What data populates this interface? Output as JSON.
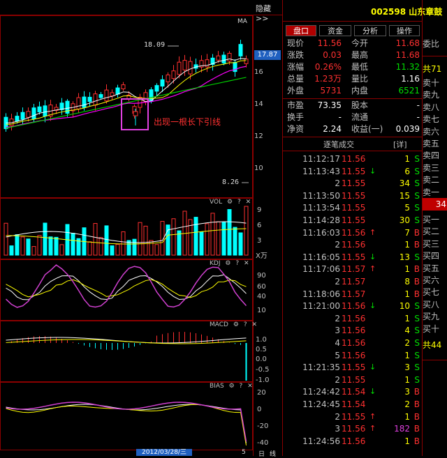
{
  "header": {
    "hide_label": "隐藏>>",
    "code_name": "002598  山东章鼓"
  },
  "tabs": [
    {
      "label": "盘口",
      "active": true
    },
    {
      "label": "资金",
      "active": false
    },
    {
      "label": "分析",
      "active": false
    },
    {
      "label": "操作",
      "active": false
    }
  ],
  "quote": [
    {
      "l1": "现价",
      "v1": "11.56",
      "l2": "今开",
      "v2": "11.68",
      "c2": "#ff3030"
    },
    {
      "l1": "涨跌",
      "v1": "0.03",
      "l2": "最高",
      "v2": "11.68",
      "c2": "#ff3030"
    },
    {
      "l1": "涨幅",
      "v1": "0.26%",
      "l2": "最低",
      "v2": "11.32",
      "c2": "#00e000"
    },
    {
      "l1": "总量",
      "v1": "1.23万",
      "l2": "量比",
      "v2": "1.16",
      "c2": "#ffffff"
    },
    {
      "l1": "外盘",
      "v1": "5731",
      "l2": "内盘",
      "v2": "6521",
      "c2": "#00e000"
    }
  ],
  "info": [
    {
      "l1": "市盈",
      "v1": "73.35",
      "l2": "股本",
      "v2": "-"
    },
    {
      "l1": "换手",
      "v1": "-",
      "l2": "流通",
      "v2": "-"
    },
    {
      "l1": "净资",
      "v1": "2.24",
      "l2": "收益(一)",
      "v2": "0.039"
    }
  ],
  "trades_header": {
    "title": "逐笔成交",
    "detail": "[详]"
  },
  "trades": [
    {
      "t": "11:12:17",
      "p": "11.56",
      "a": "",
      "ac": "",
      "v": "1",
      "d": "S",
      "dc": "#00e000"
    },
    {
      "t": "11:13:43",
      "p": "11.55",
      "a": "↓",
      "ac": "#00e000",
      "v": "6",
      "d": "S",
      "dc": "#00e000"
    },
    {
      "t": "2",
      "p": "11.55",
      "a": "",
      "ac": "",
      "v": "34",
      "d": "S",
      "dc": "#00e000"
    },
    {
      "t": "11:13:50",
      "p": "11.55",
      "a": "",
      "ac": "",
      "v": "15",
      "d": "S",
      "dc": "#00e000"
    },
    {
      "t": "11:13:54",
      "p": "11.55",
      "a": "",
      "ac": "",
      "v": "5",
      "d": "S",
      "dc": "#00e000"
    },
    {
      "t": "11:14:28",
      "p": "11.55",
      "a": "",
      "ac": "",
      "v": "30",
      "d": "S",
      "dc": "#00e000"
    },
    {
      "t": "11:16:03",
      "p": "11.56",
      "a": "↑",
      "ac": "#ff3030",
      "v": "7",
      "d": "B",
      "dc": "#ff3030"
    },
    {
      "t": "2",
      "p": "11.56",
      "a": "",
      "ac": "",
      "v": "1",
      "d": "B",
      "dc": "#ff3030"
    },
    {
      "t": "11:16:05",
      "p": "11.55",
      "a": "↓",
      "ac": "#00e000",
      "v": "13",
      "d": "S",
      "dc": "#00e000"
    },
    {
      "t": "11:17:06",
      "p": "11.57",
      "a": "↑",
      "ac": "#ff3030",
      "v": "1",
      "d": "B",
      "dc": "#ff3030"
    },
    {
      "t": "2",
      "p": "11.57",
      "a": "",
      "ac": "",
      "v": "8",
      "d": "B",
      "dc": "#ff3030"
    },
    {
      "t": "11:18:06",
      "p": "11.57",
      "a": "",
      "ac": "",
      "v": "1",
      "d": "B",
      "dc": "#ff3030"
    },
    {
      "t": "11:21:00",
      "p": "11.56",
      "a": "↓",
      "ac": "#00e000",
      "v": "10",
      "d": "S",
      "dc": "#00e000"
    },
    {
      "t": "2",
      "p": "11.56",
      "a": "",
      "ac": "",
      "v": "1",
      "d": "S",
      "dc": "#00e000"
    },
    {
      "t": "3",
      "p": "11.56",
      "a": "",
      "ac": "",
      "v": "4",
      "d": "S",
      "dc": "#00e000"
    },
    {
      "t": "4",
      "p": "11.56",
      "a": "",
      "ac": "",
      "v": "2",
      "d": "S",
      "dc": "#00e000"
    },
    {
      "t": "5",
      "p": "11.56",
      "a": "",
      "ac": "",
      "v": "1",
      "d": "S",
      "dc": "#00e000"
    },
    {
      "t": "11:21:35",
      "p": "11.55",
      "a": "↓",
      "ac": "#00e000",
      "v": "3",
      "d": "S",
      "dc": "#00e000"
    },
    {
      "t": "2",
      "p": "11.55",
      "a": "",
      "ac": "",
      "v": "1",
      "d": "S",
      "dc": "#00e000"
    },
    {
      "t": "11:24:42",
      "p": "11.54",
      "a": "↓",
      "ac": "#00e000",
      "v": "3",
      "d": "B",
      "dc": "#ff3030"
    },
    {
      "t": "11:24:45",
      "p": "11.54",
      "a": "",
      "ac": "",
      "v": "2",
      "d": "B",
      "dc": "#ff3030"
    },
    {
      "t": "2",
      "p": "11.55",
      "a": "↑",
      "ac": "#ff3030",
      "v": "1",
      "d": "B",
      "dc": "#ff3030"
    },
    {
      "t": "3",
      "p": "11.56",
      "a": "↑",
      "ac": "#ff3030",
      "v": "182",
      "d": "B",
      "dc": "#ff3030"
    },
    {
      "t": "11:24:56",
      "p": "11.56",
      "a": "",
      "ac": "",
      "v": "1",
      "d": "B",
      "dc": "#ff3030"
    }
  ],
  "far": {
    "top": "委比",
    "total_sell": "共71",
    "sells": [
      "卖十",
      "卖九",
      "卖八",
      "卖七",
      "卖六",
      "卖五",
      "卖四",
      "卖三",
      "卖二",
      "卖一"
    ],
    "mid": "34",
    "buys": [
      "买一",
      "买二",
      "买三",
      "买四",
      "买五",
      "买六",
      "买七",
      "买八",
      "买九",
      "买十"
    ],
    "total_buy": "共44"
  },
  "kline": {
    "ma_label": "MA",
    "high_label": "18.09",
    "low_label": "8.26",
    "current_price_tag": "17.87",
    "annotation": "出现一根长下引线",
    "yaxis": [
      "16",
      "14",
      "12",
      "10"
    ]
  },
  "vol": {
    "title": "VOL",
    "yaxis": [
      "9",
      "6",
      "3"
    ],
    "unit": "X万"
  },
  "kdj": {
    "title": "KDJ",
    "yaxis": [
      "90",
      "60",
      "40",
      "10"
    ]
  },
  "macd": {
    "title": "MACD",
    "yaxis": [
      "1.0",
      "0.5",
      "0.0",
      "-0.5",
      "-1.0"
    ]
  },
  "bias": {
    "title": "BIAS",
    "yaxis": [
      "20",
      "0",
      "-20",
      "-40"
    ]
  },
  "footer": {
    "date": "2012/03/28/三",
    "right1": "日",
    "right2": "线",
    "num": "5"
  },
  "panel_icons": {
    "gear": "⚙",
    "help": "?",
    "close": "✕"
  },
  "colors": {
    "up": "#ff3030",
    "down": "#00ffff",
    "ma5": "#ffffff",
    "ma10": "#ffff00",
    "ma20": "#ff00ff",
    "ma60": "#00e000",
    "border": "#8b0000"
  }
}
